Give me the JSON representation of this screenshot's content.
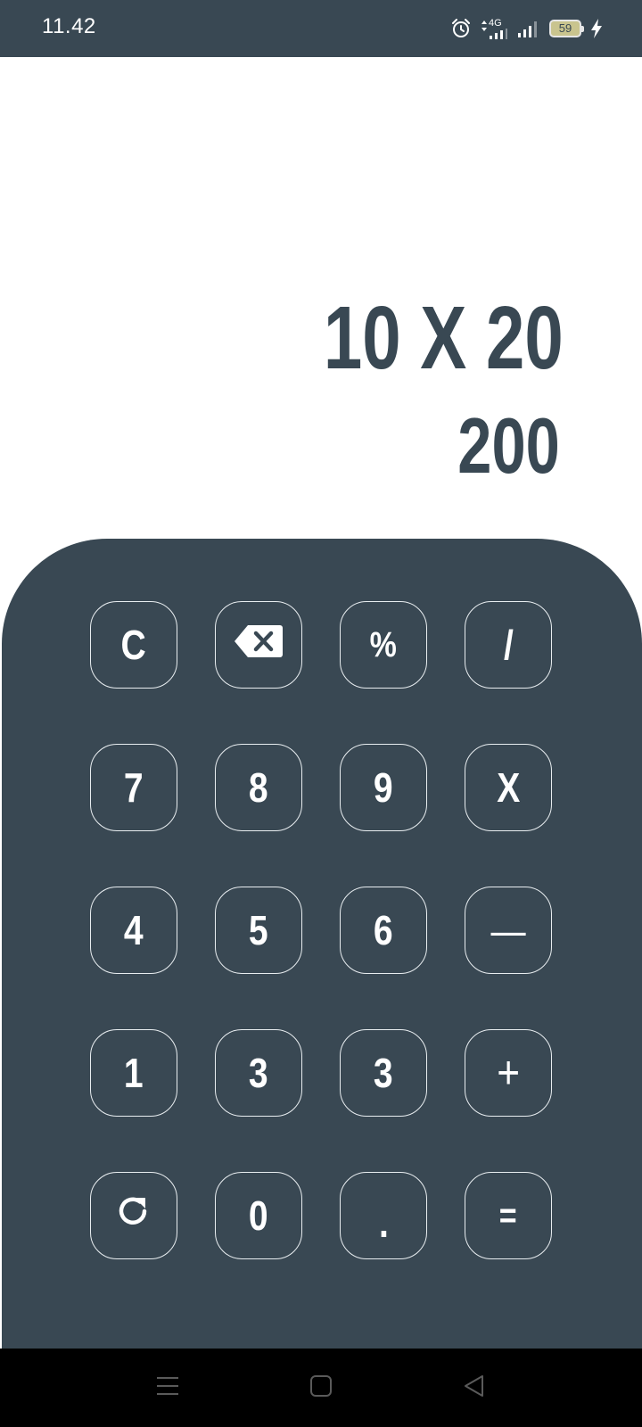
{
  "status_bar": {
    "time": "11.42",
    "network": "4G",
    "battery_level": "59",
    "icons": [
      "alarm-icon",
      "mobile-data-signal-icon",
      "signal-icon",
      "battery-icon",
      "charging-bolt-icon"
    ]
  },
  "display": {
    "expression": "10 X 20",
    "result": "200"
  },
  "keypad": {
    "keys": [
      {
        "id": "clear",
        "label": "C"
      },
      {
        "id": "backspace",
        "label": "",
        "icon": "backspace-icon"
      },
      {
        "id": "percent",
        "label": "%"
      },
      {
        "id": "divide",
        "label": "/"
      },
      {
        "id": "seven",
        "label": "7"
      },
      {
        "id": "eight",
        "label": "8"
      },
      {
        "id": "nine",
        "label": "9"
      },
      {
        "id": "multiply",
        "label": "X"
      },
      {
        "id": "four",
        "label": "4"
      },
      {
        "id": "five",
        "label": "5"
      },
      {
        "id": "six",
        "label": "6"
      },
      {
        "id": "minus",
        "label": "—"
      },
      {
        "id": "one",
        "label": "1"
      },
      {
        "id": "three-a",
        "label": "3"
      },
      {
        "id": "three-b",
        "label": "3"
      },
      {
        "id": "plus",
        "label": "+"
      },
      {
        "id": "reset",
        "label": "",
        "icon": "refresh-icon"
      },
      {
        "id": "zero",
        "label": "0"
      },
      {
        "id": "decimal",
        "label": "."
      },
      {
        "id": "equals",
        "label": "="
      }
    ]
  },
  "nav_bar": {
    "icons": [
      "menu-icon",
      "home-icon",
      "back-icon"
    ]
  },
  "colors": {
    "primary": "#394853",
    "background": "#ffffff",
    "key_border": "#e8edf0",
    "nav_bar": "#000000"
  }
}
